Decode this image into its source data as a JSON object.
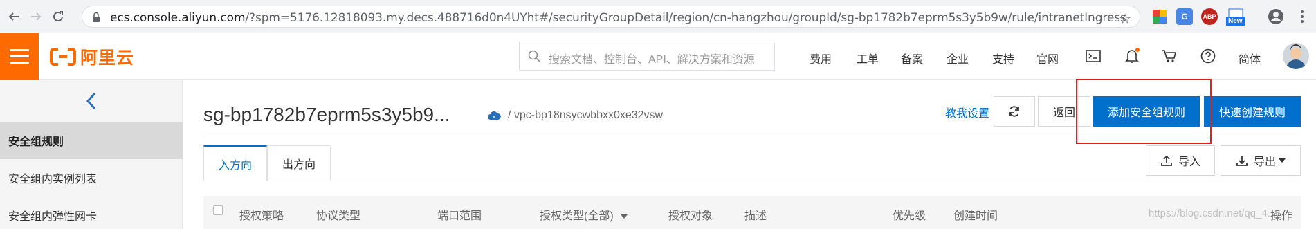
{
  "browser": {
    "url_host": "ecs.console.aliyun.com",
    "url_rest": "/?spm=5176.12818093.my.decs.488716d0n4UYht#/securityGroupDetail/region/cn-hangzhou/groupId/sg-bp1782b7eprm5s3y5b9w/rule/intranetIngress",
    "ext_new_label": "New",
    "abp_label": "ABP"
  },
  "header": {
    "logo_text": "阿里云",
    "search_placeholder": "搜索文档、控制台、API、解决方案和资源",
    "nav": [
      "费用",
      "工单",
      "备案",
      "企业",
      "支持",
      "官网"
    ],
    "lang": "简体"
  },
  "sidebar": {
    "items": [
      {
        "label": "安全组规则"
      },
      {
        "label": "安全组内实例列表"
      },
      {
        "label": "安全组内弹性网卡"
      }
    ]
  },
  "main": {
    "title": "sg-bp1782b7eprm5s3y5b9...",
    "vpc": "/ vpc-bp18nsycwbbxx0xe32vsw",
    "help_link": "教我设置",
    "back_button": "返回",
    "add_rule_button": "添加安全组规则",
    "quick_rule_button": "快速创建规则",
    "tabs": [
      {
        "label": "入方向"
      },
      {
        "label": "出方向"
      }
    ],
    "import_button": "导入",
    "export_button": "导出",
    "columns": [
      "授权策略",
      "协议类型",
      "端口范围",
      "授权类型(全部)",
      "授权对象",
      "描述",
      "优先级",
      "创建时间",
      "操作"
    ]
  },
  "watermark": "https://blog.csdn.net/qq_4..."
}
